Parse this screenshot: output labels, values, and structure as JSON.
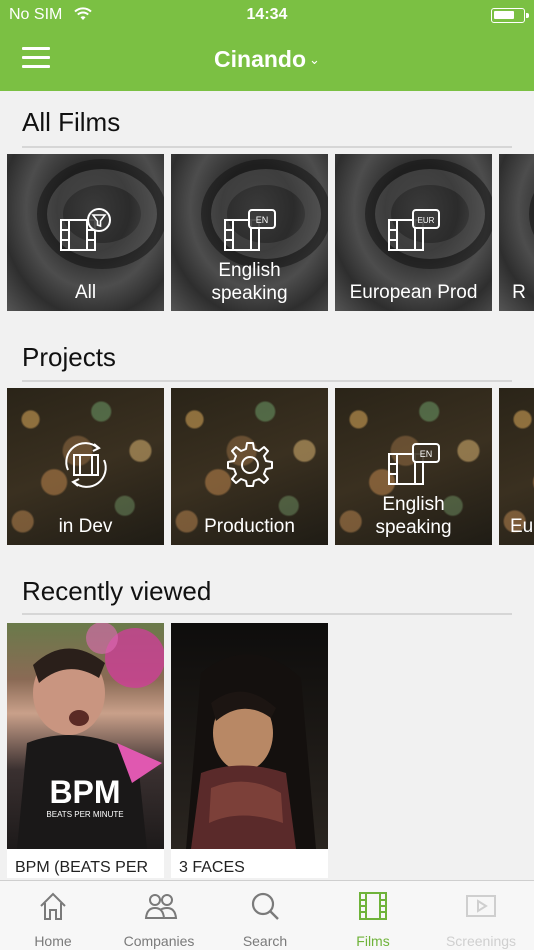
{
  "status_bar": {
    "carrier": "No SIM",
    "time": "14:34"
  },
  "header": {
    "title": "Cinando"
  },
  "all_films": {
    "title": "All Films",
    "tiles": [
      {
        "label": "All",
        "icon": "film-filter-icon"
      },
      {
        "label": "English\nspeaking",
        "icon": "film-en-icon",
        "badge": "EN"
      },
      {
        "label": "European Prod",
        "icon": "film-eur-icon",
        "badge": "EUR"
      },
      {
        "label": "R",
        "icon": "film-icon"
      }
    ]
  },
  "projects": {
    "title": "Projects",
    "tiles": [
      {
        "label": "in Dev",
        "icon": "film-cycle-icon"
      },
      {
        "label": "Production",
        "icon": "gear-icon"
      },
      {
        "label": "English\nspeaking",
        "icon": "film-en-icon",
        "badge": "EN"
      },
      {
        "label": "Eu",
        "icon": "film-icon"
      }
    ]
  },
  "recently_viewed": {
    "title": "Recently viewed",
    "items": [
      {
        "caption": "BPM (BEATS PER",
        "poster_title": "BPM",
        "poster_subtitle": "BEATS PER MINUTE"
      },
      {
        "caption": "3 FACES"
      }
    ]
  },
  "tabbar": {
    "tabs": [
      {
        "label": "Home",
        "icon": "home-icon",
        "state": "normal"
      },
      {
        "label": "Companies",
        "icon": "companies-icon",
        "state": "normal"
      },
      {
        "label": "Search",
        "icon": "search-icon",
        "state": "normal"
      },
      {
        "label": "Films",
        "icon": "film-icon",
        "state": "active"
      },
      {
        "label": "Screenings",
        "icon": "play-icon",
        "state": "disabled"
      }
    ]
  },
  "colors": {
    "brand_green": "#7bc043",
    "active_tab": "#6fb33a"
  }
}
